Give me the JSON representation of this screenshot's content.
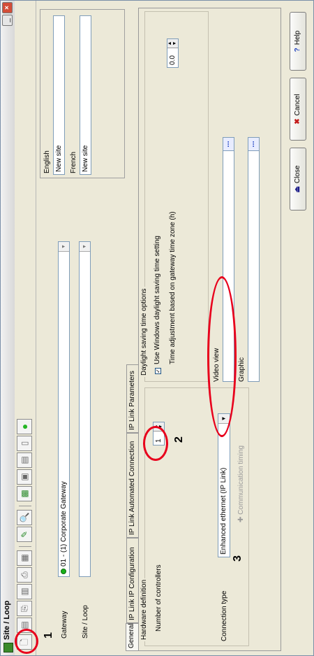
{
  "window": {
    "title": "Site / Loop",
    "min_icon": "minimize-icon",
    "close_icon": "close-icon",
    "close_glyph": "×",
    "min_glyph": "_"
  },
  "toolbar": {
    "tools": [
      {
        "name": "new-icon",
        "glyph": "🗋"
      },
      {
        "name": "save-icon",
        "glyph": "▤"
      },
      {
        "name": "copy-icon",
        "glyph": "⎘"
      },
      {
        "name": "paste-icon",
        "glyph": "▥"
      },
      {
        "name": "print-icon",
        "glyph": "⎙"
      },
      {
        "name": "list-icon",
        "glyph": "▦"
      },
      {
        "name": "search-icon",
        "glyph": "✎"
      },
      {
        "name": "find-icon",
        "glyph": "🔍"
      },
      {
        "name": "controller-icon",
        "glyph": "▩"
      },
      {
        "name": "device-config-icon",
        "glyph": "▣"
      },
      {
        "name": "network-icon",
        "glyph": "▤"
      },
      {
        "name": "panel-icon",
        "glyph": "▯"
      },
      {
        "name": "online-status-icon",
        "glyph": "●"
      }
    ]
  },
  "form": {
    "gateway_label": "Gateway",
    "gateway_value": "01 - (1) Corporate Gateway",
    "site_loop_label": "Site / Loop",
    "site_loop_value": ""
  },
  "languages": [
    {
      "language": "English",
      "value": "New site"
    },
    {
      "language": "French",
      "value": "New site"
    }
  ],
  "tabs": [
    {
      "label": "General",
      "active": true
    },
    {
      "label": "IP Link IP Configuration",
      "active": false
    },
    {
      "label": "IP Link Automated Connection",
      "active": false
    },
    {
      "label": "IP Link Parameters",
      "active": false
    }
  ],
  "general": {
    "hardware_group": "Hardware definition",
    "controllers_label": "Number of controllers",
    "controllers_value": "1",
    "connection_type_label": "Connection type",
    "connection_type_value": "Enhanced ethernet (IP Link)",
    "comm_timing_label": "Communication timing",
    "dst_group": "Daylight saving time options",
    "dst_checkbox_label": "Use Windows daylight saving time setting",
    "dst_checked": true,
    "time_adjust_label": "Time adjustment based on gateway time zone (h)",
    "time_adjust_value": "0.0",
    "video_view_label": "Video view",
    "video_view_value": "",
    "graphic_label": "Graphic",
    "graphic_value": "",
    "ellipsis": "..."
  },
  "buttons": {
    "close": "Close",
    "cancel": "Cancel",
    "help": "Help"
  },
  "annotations": {
    "n1": "1",
    "n2": "2",
    "n3": "3",
    "color": "#e8001c"
  },
  "colors": {
    "active_status": "#19b119",
    "annotation": "#e8001c"
  }
}
